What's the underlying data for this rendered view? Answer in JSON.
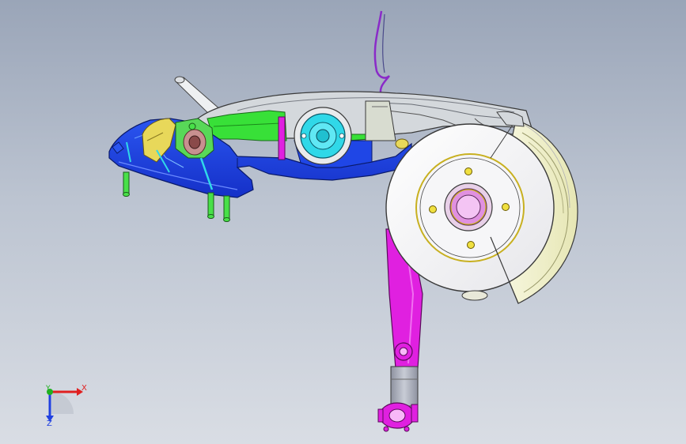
{
  "viewport": {
    "background_top": "#9aa5b8",
    "background_bottom": "#d9dde4"
  },
  "triad": {
    "x_label": "X",
    "y_label": "Y",
    "z_label": "Z",
    "x_color": "#e02020",
    "y_color": "#20b020",
    "z_color": "#2040e0"
  },
  "model": {
    "description_icon": "rear-suspension-assembly",
    "colors": {
      "subframe_blue": "#1a3fe0",
      "bracket_yellow": "#e8d85a",
      "arm_green": "#38e038",
      "bushing_cyan": "#30d8e8",
      "trailing_arm_gray": "#d4d8dc",
      "brake_disc": "#f4f4f6",
      "brake_shield": "#f2f2d0",
      "hub_pink": "#e890e0",
      "shock_magenta": "#e020e0",
      "shock_gray": "#a8acb6",
      "wire_purple": "#8a2bc8",
      "stud_green": "#48e048"
    }
  }
}
